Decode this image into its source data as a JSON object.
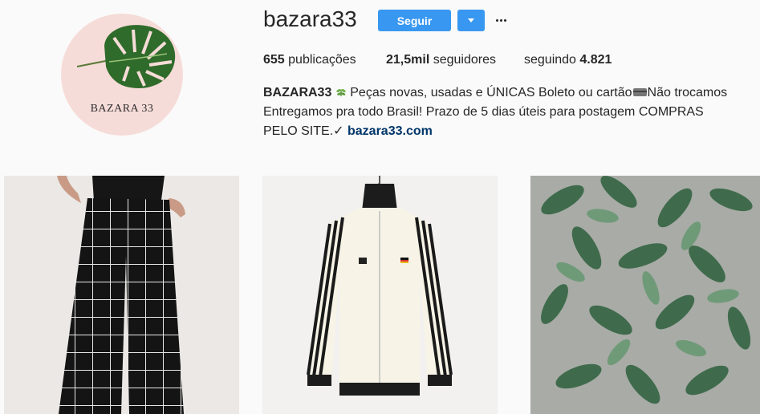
{
  "profile": {
    "username": "bazara33",
    "avatar_text": "BAZARA 33",
    "follow_label": "Seguir",
    "dropdown_icon": "caret-down-icon",
    "more_icon": "ellipsis-icon"
  },
  "stats": {
    "posts_count": "655",
    "posts_label": " publicações",
    "followers_count": "21,5mil",
    "followers_label": " seguidores",
    "following_label": "seguindo ",
    "following_count": "4.821"
  },
  "bio": {
    "name": "BAZARA33",
    "text1": " Peças novas, usadas e ÚNICAS Boleto ou cartão",
    "text2": "Não trocamos Entregamos pra todo Brasil! Prazo de 5 dias úteis para postagem COMPRAS PELO SITE.✓ ",
    "link": "bazara33.com"
  },
  "colors": {
    "accent": "#3897f0",
    "link": "#003569",
    "avatar_bg": "#f6dcd8"
  },
  "posts": [
    {
      "subject": "black-grid-pattern-wide-pants"
    },
    {
      "subject": "cream-track-jacket-black-stripes"
    },
    {
      "subject": "green-leafy-plants"
    }
  ]
}
